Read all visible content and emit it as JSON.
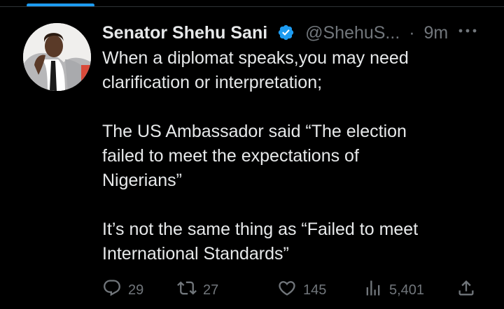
{
  "tweet": {
    "author": {
      "display_name": "Senator Shehu Sani",
      "handle": "@ShehuS...",
      "verified": true
    },
    "separator": "·",
    "time": "9m",
    "text": "When a diplomat speaks,you may need\nclarification or interpretation;\n\nThe US Ambassador said “The election\nfailed to meet the expectations of\nNigerians”\n\nIt’s not the same thing as “Failed to meet\nInternational Standards”",
    "actions": {
      "replies": "29",
      "retweets": "27",
      "likes": "145",
      "views": "5,401"
    }
  },
  "icons": {
    "verified": "verified-badge-icon",
    "more": "more-icon",
    "reply": "reply-icon",
    "retweet": "retweet-icon",
    "like": "heart-icon",
    "views": "views-icon",
    "share": "share-icon"
  },
  "colors": {
    "background": "#000000",
    "text": "#e7e9ea",
    "muted": "#71767b",
    "accent": "#1d9bf0"
  }
}
